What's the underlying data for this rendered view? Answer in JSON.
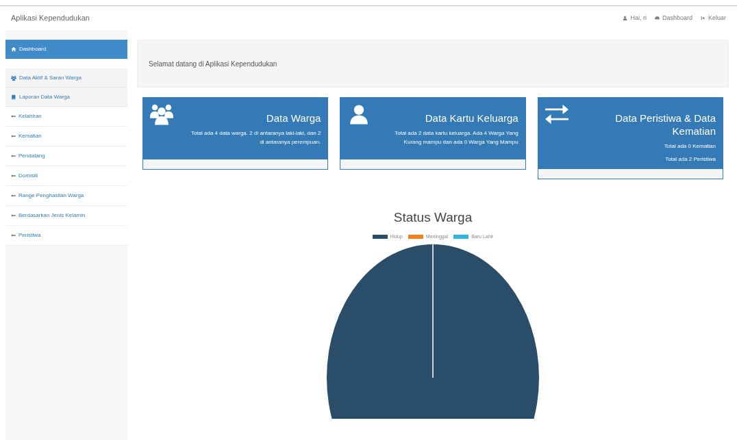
{
  "header": {
    "title": "Aplikasi Kependudukan",
    "links": [
      {
        "label": "Hai, ri"
      },
      {
        "label": "Dashboard"
      },
      {
        "label": "Keluar"
      }
    ]
  },
  "sidebar": {
    "items": [
      {
        "label": "Dashboard",
        "selected": true
      },
      {
        "label": "Data Aktif & Saran Warga",
        "selected": false
      },
      {
        "label": "Laporan Data Warga",
        "selected": false,
        "children": [
          {
            "label": "Kelahiran",
            "selected": false
          },
          {
            "label": "Kematian",
            "selected": false
          },
          {
            "label": "Pendatang",
            "selected": false
          },
          {
            "label": "Domisili",
            "selected": false
          },
          {
            "label": "Range Penghasilan Warga",
            "selected": false
          },
          {
            "label": "Berdasarkan Jenis Kelamin",
            "selected": false
          },
          {
            "label": "Peristiwa",
            "selected": false
          }
        ]
      }
    ]
  },
  "welcome": "Selamat datang di Aplikasi Kependudukan",
  "cards": [
    {
      "title": "Data Warga",
      "lines": [
        "Total ada 4 data warga. 2 di antaranya laki-laki, dan 2 di antaranya perempuan."
      ]
    },
    {
      "title": "Data Kartu Keluarga",
      "lines": [
        "Total ada 2 data kartu keluarga. Ada 4 Warga Yang Kurang mampu dan ada 0 Warga Yang Mampu"
      ]
    },
    {
      "title": "Data Peristiwa & Data Kematian",
      "lines": [
        "Total ada 0 Kematian",
        "Total ada 2 Peristiwa"
      ]
    }
  ],
  "chart": {
    "chart_data": {
      "type": "pie",
      "title": "Status Warga",
      "categories": [
        "Hidup",
        "Meninggal",
        "Baru Lahir"
      ],
      "values": [
        100,
        0,
        0
      ],
      "colors": [
        "#2a4d69",
        "#f57c1f",
        "#29b6e0"
      ]
    }
  }
}
